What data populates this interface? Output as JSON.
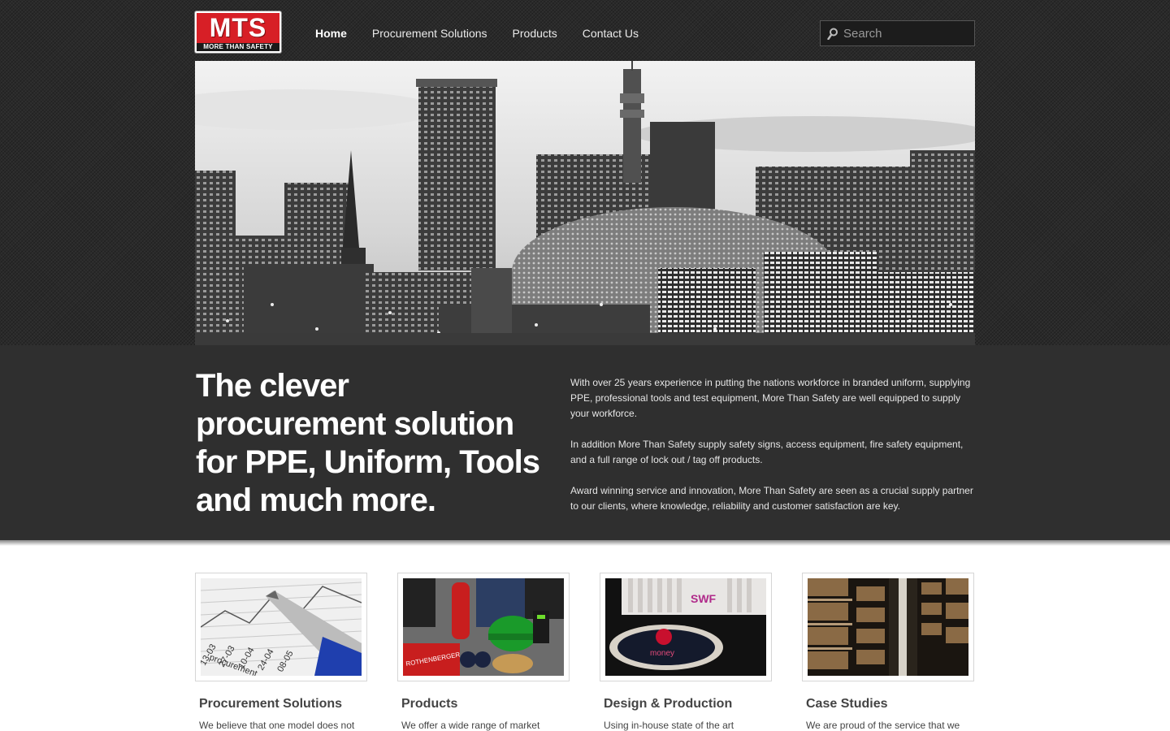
{
  "logo": {
    "mark": "MTS",
    "tagline": "MORE THAN SAFETY"
  },
  "nav": {
    "items": [
      "Home",
      "Procurement Solutions",
      "Products",
      "Contact Us"
    ],
    "active": "Home"
  },
  "search": {
    "placeholder": "Search",
    "icon": "search-icon"
  },
  "hero": {
    "image": "city-skyline-photo"
  },
  "intro": {
    "headline": "The clever procurement solution for PPE, Uniform, Tools and much more.",
    "paragraphs": [
      "With over 25 years experience in putting the nations workforce in branded uniform, supplying PPE, professional tools and test equipment, More Than Safety are well equipped to supply your workforce.",
      "In addition More Than Safety supply safety signs, access equipment, fire safety equipment, and a full range of lock out / tag off products.",
      "Award winning service and innovation, More Than Safety are seen as a crucial supply partner to our clients, where knowledge, reliability and customer satisfaction are key."
    ]
  },
  "cards": [
    {
      "title": "Procurement Solutions",
      "text": "We believe that one model does not",
      "image": "pen-chart-photo"
    },
    {
      "title": "Products",
      "text": "We offer a wide range of market",
      "image": "ppe-products-photo"
    },
    {
      "title": "Design & Production",
      "text": "Using  in-house state of the art",
      "image": "embroidery-machine-photo"
    },
    {
      "title": "Case Studies",
      "text": "We are proud of the service that we",
      "image": "warehouse-shelves-photo"
    }
  ],
  "colors": {
    "brand_red": "#d71f26",
    "band_dark": "#2f2f2f",
    "header_dark": "#2a2a2a"
  }
}
